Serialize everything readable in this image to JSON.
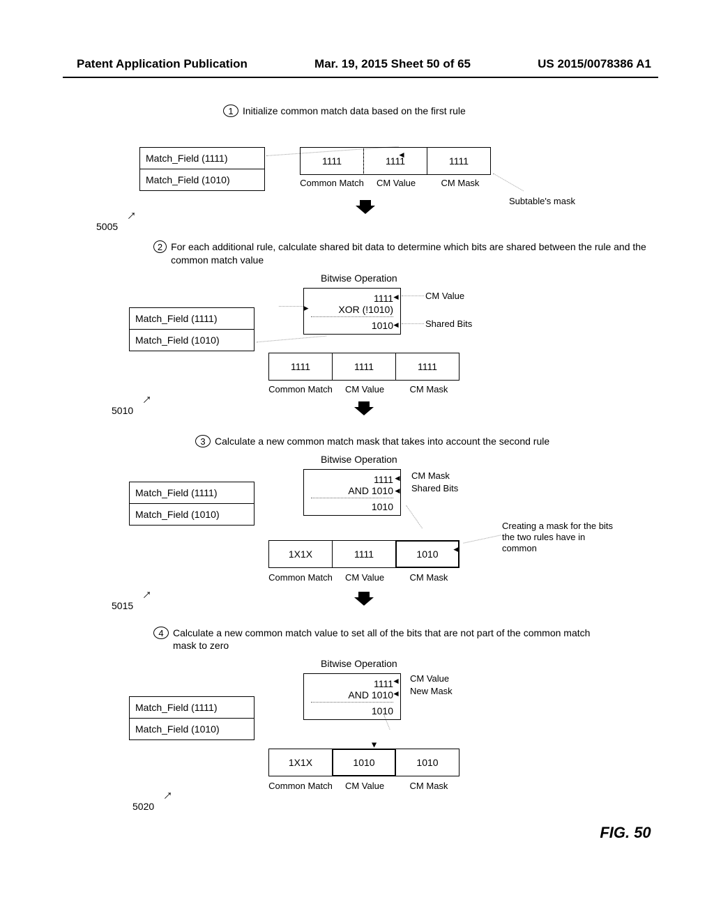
{
  "header": {
    "left": "Patent Application Publication",
    "center": "Mar. 19, 2015  Sheet 50 of 65",
    "right": "US 2015/0078386 A1"
  },
  "steps": {
    "s1": {
      "num": "1",
      "text": "Initialize common match data based on the first rule"
    },
    "s2": {
      "num": "2",
      "text": "For each additional rule, calculate shared bit data to determine which bits are shared between the rule and the common match value"
    },
    "s3": {
      "num": "3",
      "text": "Calculate a new common match mask that takes into account the second rule"
    },
    "s4": {
      "num": "4",
      "text": "Calculate a new common match value to set all of the bits that are not part of the common match mask to zero"
    }
  },
  "match_fields": {
    "a": "Match_Field (1111)",
    "b": "Match_Field (1010)"
  },
  "refs": {
    "r1": "5005",
    "r2": "5010",
    "r3": "5015",
    "r4": "5020"
  },
  "bitop_label": "Bitwise Operation",
  "stage1": {
    "common_match": "1111",
    "cm_value": "1111",
    "cm_mask": "1111",
    "subtable_mask_label": "Subtable's mask"
  },
  "labels": {
    "common_match": "Common Match",
    "cm_value": "CM Value",
    "cm_mask": "CM Mask",
    "shared_bits": "Shared Bits",
    "new_mask": "New Mask"
  },
  "stage2": {
    "op_top": "1111",
    "op_mid": "XOR (!1010)",
    "op_res": "1010",
    "anno_top": "CM Value",
    "anno_res": "Shared Bits",
    "common_match": "1111",
    "cm_value": "1111",
    "cm_mask": "1111"
  },
  "stage3": {
    "op_top": "1111",
    "op_mid": "AND 1010",
    "op_res": "1010",
    "anno_top": "CM Mask",
    "anno_mid": "Shared Bits",
    "right_note": "Creating a mask for the bits the two rules have in common",
    "common_match": "1X1X",
    "cm_value": "1111",
    "cm_mask": "1010"
  },
  "stage4": {
    "op_top": "1111",
    "op_mid": "AND 1010",
    "op_res": "1010",
    "anno_top": "CM Value",
    "anno_mid": "New Mask",
    "common_match": "1X1X",
    "cm_value": "1010",
    "cm_mask": "1010"
  },
  "figure_caption": "FIG. 50"
}
